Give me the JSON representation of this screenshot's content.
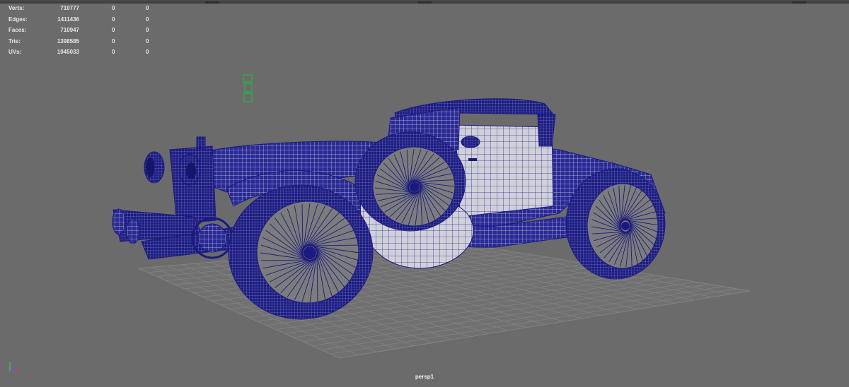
{
  "hud": {
    "rows": [
      {
        "label": "Verts:",
        "v1": "710777",
        "v2": "0",
        "v3": "0"
      },
      {
        "label": "Edges:",
        "v1": "1411436",
        "v2": "0",
        "v3": "0"
      },
      {
        "label": "Faces:",
        "v1": "710947",
        "v2": "0",
        "v3": "0"
      },
      {
        "label": "Tris:",
        "v1": "1398585",
        "v2": "0",
        "v3": "0"
      },
      {
        "label": "UVs:",
        "v1": "1045033",
        "v2": "0",
        "v3": "0"
      }
    ]
  },
  "camera": {
    "name": "persp1"
  },
  "colors": {
    "background": "#6b6b6b",
    "wireframe": "#1f1f8c",
    "surface": "#c8c8d0",
    "grid": "#7f7f7f",
    "manipulator": "#2fa84a"
  },
  "icons": {
    "axis": "axis-gizmo-icon",
    "manipulator": "light-manipulator-icon"
  }
}
